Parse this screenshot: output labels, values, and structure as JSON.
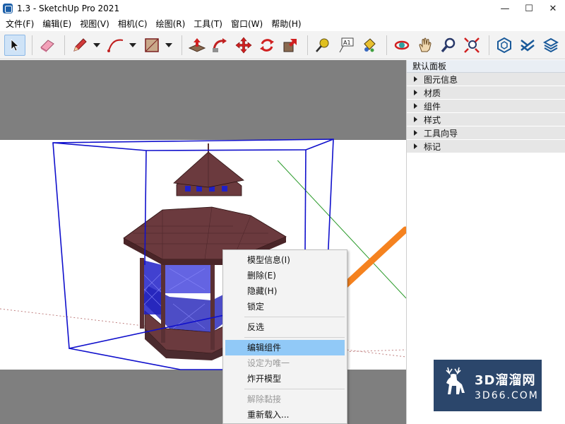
{
  "window": {
    "title": "1.3 - SketchUp Pro 2021",
    "minimize": "—",
    "maximize": "☐",
    "close": "✕"
  },
  "menubar": [
    "文件(F)",
    "编辑(E)",
    "视图(V)",
    "相机(C)",
    "绘图(R)",
    "工具(T)",
    "窗口(W)",
    "帮助(H)"
  ],
  "toolbar": {
    "text_tool_label": "A1"
  },
  "tray": {
    "title": "默认面板",
    "panels": [
      "图元信息",
      "材质",
      "组件",
      "样式",
      "工具向导",
      "标记"
    ]
  },
  "context_menu": {
    "items": [
      {
        "label": "模型信息(I)",
        "state": "normal"
      },
      {
        "label": "删除(E)",
        "state": "normal"
      },
      {
        "label": "隐藏(H)",
        "state": "normal"
      },
      {
        "label": "锁定",
        "state": "normal"
      },
      {
        "label": "反选",
        "state": "normal"
      },
      {
        "label": "编辑组件",
        "state": "highlight"
      },
      {
        "label": "设定为唯一",
        "state": "disabled"
      },
      {
        "label": "炸开模型",
        "state": "normal"
      },
      {
        "label": "解除黏接",
        "state": "disabled"
      },
      {
        "label": "重新载入...",
        "state": "normal"
      }
    ]
  },
  "watermark": {
    "cn": "3D溜溜网",
    "en": "3D66.COM"
  },
  "colors": {
    "selection_blue": "#1010cc",
    "highlight": "#91c9f7",
    "arrow_orange": "#f5821f",
    "roof_brown": "#6b3a3e",
    "axis_green": "#2a9a2a",
    "viewport_gray": "#7f7f7f"
  }
}
